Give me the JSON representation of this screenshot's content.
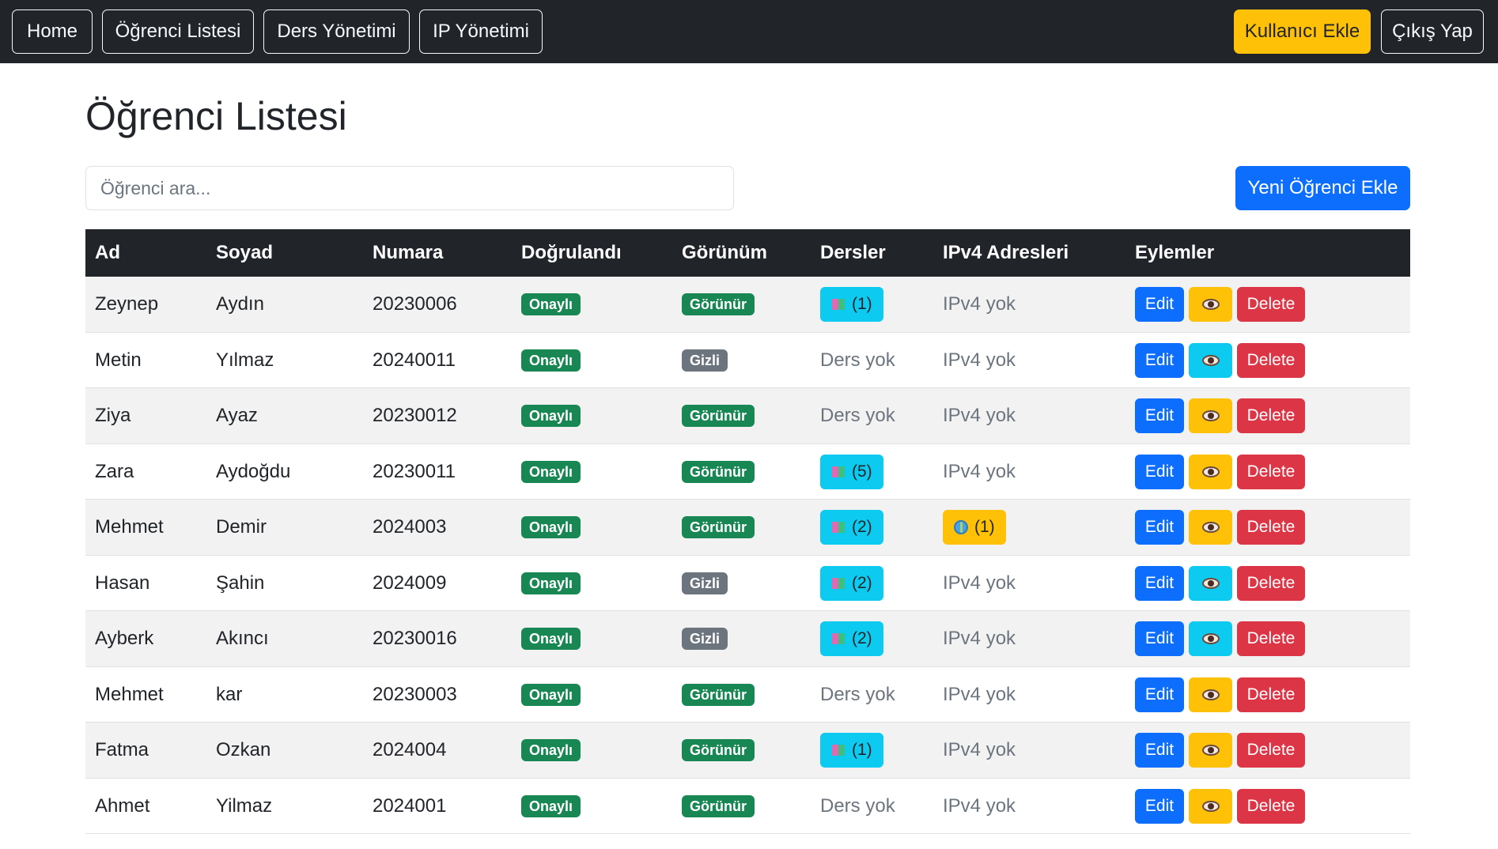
{
  "nav": {
    "left": [
      "Home",
      "Öğrenci Listesi",
      "Ders Yönetimi",
      "IP Yönetimi"
    ],
    "add_user": "Kullanıcı Ekle",
    "logout": "Çıkış Yap"
  },
  "page": {
    "title": "Öğrenci Listesi",
    "search_placeholder": "Öğrenci ara...",
    "add_student": "Yeni Öğrenci Ekle"
  },
  "table": {
    "headers": [
      "Ad",
      "Soyad",
      "Numara",
      "Doğrulandı",
      "Görünüm",
      "Dersler",
      "IPv4 Adresleri",
      "Eylemler"
    ],
    "action_labels": {
      "edit": "Edit",
      "delete": "Delete"
    },
    "rows": [
      {
        "ad": "Zeynep",
        "soyad": "Aydın",
        "numara": "20230006",
        "dogrulandi": "Onaylı",
        "gorunum": "Görünür",
        "gorunum_type": "visible",
        "dersler": "(1)",
        "dersler_type": "badge",
        "ipv4": "IPv4 yok",
        "ipv4_type": "none",
        "view_color": "warning"
      },
      {
        "ad": "Metin",
        "soyad": "Yılmaz",
        "numara": "20240011",
        "dogrulandi": "Onaylı",
        "gorunum": "Gizli",
        "gorunum_type": "hidden",
        "dersler": "Ders yok",
        "dersler_type": "none",
        "ipv4": "IPv4 yok",
        "ipv4_type": "none",
        "view_color": "info"
      },
      {
        "ad": "Ziya",
        "soyad": "Ayaz",
        "numara": "20230012",
        "dogrulandi": "Onaylı",
        "gorunum": "Görünür",
        "gorunum_type": "visible",
        "dersler": "Ders yok",
        "dersler_type": "none",
        "ipv4": "IPv4 yok",
        "ipv4_type": "none",
        "view_color": "warning"
      },
      {
        "ad": "Zara",
        "soyad": "Aydoğdu",
        "numara": "20230011",
        "dogrulandi": "Onaylı",
        "gorunum": "Görünür",
        "gorunum_type": "visible",
        "dersler": "(5)",
        "dersler_type": "badge",
        "ipv4": "IPv4 yok",
        "ipv4_type": "none",
        "view_color": "warning"
      },
      {
        "ad": "Mehmet",
        "soyad": "Demir",
        "numara": "2024003",
        "dogrulandi": "Onaylı",
        "gorunum": "Görünür",
        "gorunum_type": "visible",
        "dersler": "(2)",
        "dersler_type": "badge",
        "ipv4": "(1)",
        "ipv4_type": "badge",
        "view_color": "warning"
      },
      {
        "ad": "Hasan",
        "soyad": "Şahin",
        "numara": "2024009",
        "dogrulandi": "Onaylı",
        "gorunum": "Gizli",
        "gorunum_type": "hidden",
        "dersler": "(2)",
        "dersler_type": "badge",
        "ipv4": "IPv4 yok",
        "ipv4_type": "none",
        "view_color": "info"
      },
      {
        "ad": "Ayberk",
        "soyad": "Akıncı",
        "numara": "20230016",
        "dogrulandi": "Onaylı",
        "gorunum": "Gizli",
        "gorunum_type": "hidden",
        "dersler": "(2)",
        "dersler_type": "badge",
        "ipv4": "IPv4 yok",
        "ipv4_type": "none",
        "view_color": "info"
      },
      {
        "ad": "Mehmet",
        "soyad": "kar",
        "numara": "20230003",
        "dogrulandi": "Onaylı",
        "gorunum": "Görünür",
        "gorunum_type": "visible",
        "dersler": "Ders yok",
        "dersler_type": "none",
        "ipv4": "IPv4 yok",
        "ipv4_type": "none",
        "view_color": "warning"
      },
      {
        "ad": "Fatma",
        "soyad": "Ozkan",
        "numara": "2024004",
        "dogrulandi": "Onaylı",
        "gorunum": "Görünür",
        "gorunum_type": "visible",
        "dersler": "(1)",
        "dersler_type": "badge",
        "ipv4": "IPv4 yok",
        "ipv4_type": "none",
        "view_color": "warning"
      },
      {
        "ad": "Ahmet",
        "soyad": "Yilmaz",
        "numara": "2024001",
        "dogrulandi": "Onaylı",
        "gorunum": "Görünür",
        "gorunum_type": "visible",
        "dersler": "Ders yok",
        "dersler_type": "none",
        "ipv4": "IPv4 yok",
        "ipv4_type": "none",
        "view_color": "warning"
      }
    ]
  },
  "colors": {
    "navbar": "#212529",
    "primary": "#0d6efd",
    "warning": "#ffc107",
    "info": "#0dcaf0",
    "success": "#198754",
    "secondary": "#6c757d",
    "danger": "#dc3545"
  }
}
